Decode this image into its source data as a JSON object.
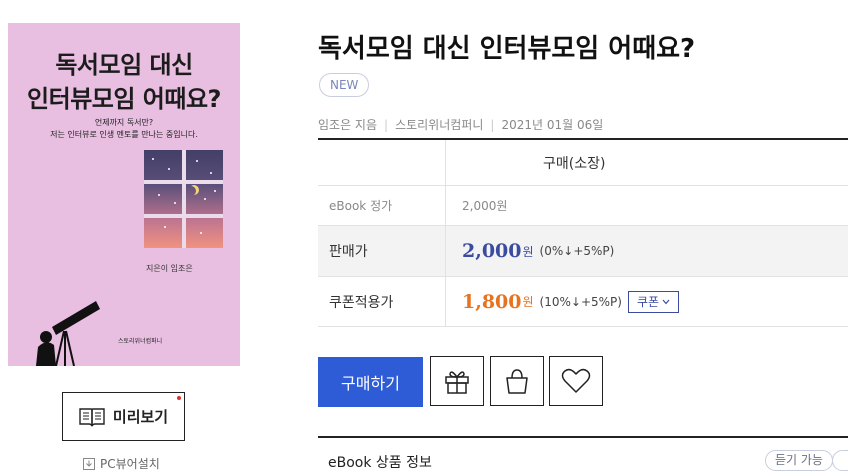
{
  "cover": {
    "title_line1": "독서모임 대신",
    "title_line2": "인터뷰모임 어때요?",
    "subtitle_line1": "언제까지 독서만?",
    "subtitle_line2": "저는 인터뷰로 인생 멘토를 만나는 중입니다.",
    "author": "지은이 임조은",
    "publisher": "스토리위너컴퍼니"
  },
  "preview": {
    "label": "미리보기"
  },
  "pc_viewer": {
    "label": "PC뷰어설치"
  },
  "book": {
    "title": "독서모임 대신 인터뷰모임 어때요?",
    "badge": "NEW",
    "author": "임조은 지음",
    "publisher": "스토리위너컴퍼니",
    "date": "2021년 01월 06일"
  },
  "price_table": {
    "header": "구매(소장)",
    "list_price_label": "eBook 정가",
    "list_price": "2,000원",
    "sale_label": "판매가",
    "sale_price": "2,000",
    "sale_unit": "원",
    "sale_note": "(0%↓+5%P)",
    "coupon_label": "쿠폰적용가",
    "coupon_price": "1,800",
    "coupon_unit": "원",
    "coupon_note": "(10%↓+5%P)",
    "coupon_button": "쿠폰"
  },
  "actions": {
    "buy_label": "구매하기",
    "gift_icon": "gift-icon",
    "cart_icon": "shopping-bag-icon",
    "wish_icon": "heart-icon"
  },
  "info": {
    "title": "eBook 상품 정보",
    "listen_badge": "듣기 가능"
  },
  "colors": {
    "accent": "#2e5bd6",
    "sale_price": "#3b4ba0",
    "coupon_price": "#e8731f",
    "cover_bg": "#e8bfe0"
  }
}
